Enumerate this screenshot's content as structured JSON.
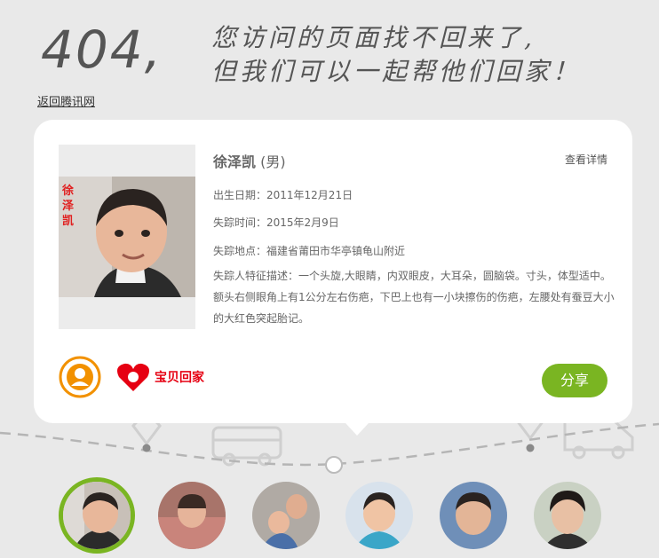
{
  "header": {
    "code": "404,",
    "line1": "您访问的页面找不回来了,",
    "line2": "但我们可以一起帮他们回家！",
    "back_link": "返回腾讯网"
  },
  "card": {
    "name": "徐泽凯",
    "gender": "(男)",
    "photo_caption": "徐泽凯",
    "detail_link": "查看详情",
    "birth": "出生日期：2011年12月21日",
    "missing_time": "失踪时间：2015年2月9日",
    "missing_place": "失踪地点：福建省莆田市华亭镇龟山附近",
    "features": "失踪人特征描述：一个头旋,大眼睛，内双眼皮，大耳朵，圆脑袋。寸头，体型适中。额头右侧眼角上有1公分左右伤疤，下巴上也有一小块擦伤的伤疤，左腰处有蚕豆大小的大红色突起胎记。",
    "share_label": "分享",
    "logo2_text": "宝贝回家"
  },
  "colors": {
    "accent": "#7ab522",
    "logo_orange": "#f29100",
    "logo_red": "#e60012"
  },
  "thumbnails": [
    {
      "name": "徐泽凯",
      "active": true
    },
    {
      "active": false
    },
    {
      "active": false
    },
    {
      "active": false
    },
    {
      "active": false
    },
    {
      "active": false
    }
  ]
}
